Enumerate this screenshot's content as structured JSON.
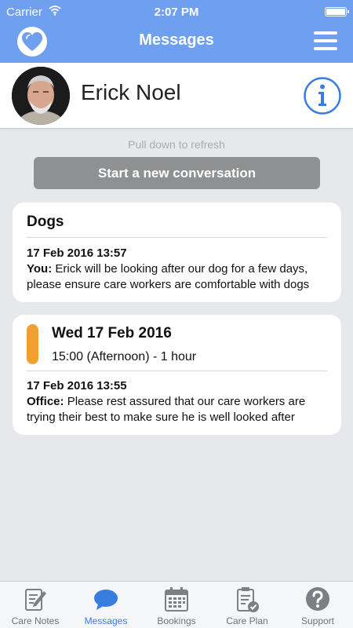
{
  "status_bar": {
    "carrier": "Carrier",
    "time": "2:07 PM"
  },
  "nav": {
    "title": "Messages"
  },
  "profile": {
    "name": "Erick Noel"
  },
  "pull_hint": "Pull down to refresh",
  "new_conversation_label": "Start a new conversation",
  "conversations": [
    {
      "title": "Dogs",
      "last_date": "17 Feb 2016 13:57",
      "sender": "You:",
      "preview": "Erick will be looking after our dog for a few days, please ensure care workers are comfortable with dogs"
    },
    {
      "booking_date": "Wed 17 Feb 2016",
      "booking_time": "15:00 (Afternoon) - 1 hour",
      "last_date": "17 Feb 2016 13:55",
      "sender": "Office:",
      "preview": "Please rest assured that our care workers are trying their best to make sure he is well looked after"
    }
  ],
  "tabs": [
    {
      "label": "Care Notes",
      "icon": "care-notes-icon"
    },
    {
      "label": "Messages",
      "icon": "messages-icon",
      "active": true
    },
    {
      "label": "Bookings",
      "icon": "calendar-icon"
    },
    {
      "label": "Care Plan",
      "icon": "clipboard-check-icon"
    },
    {
      "label": "Support",
      "icon": "question-icon"
    }
  ],
  "colors": {
    "nav_bg": "#6fa0ef",
    "accent": "#3a7de0",
    "booking_marker": "#f0a030",
    "button_bg": "#8f9091"
  }
}
